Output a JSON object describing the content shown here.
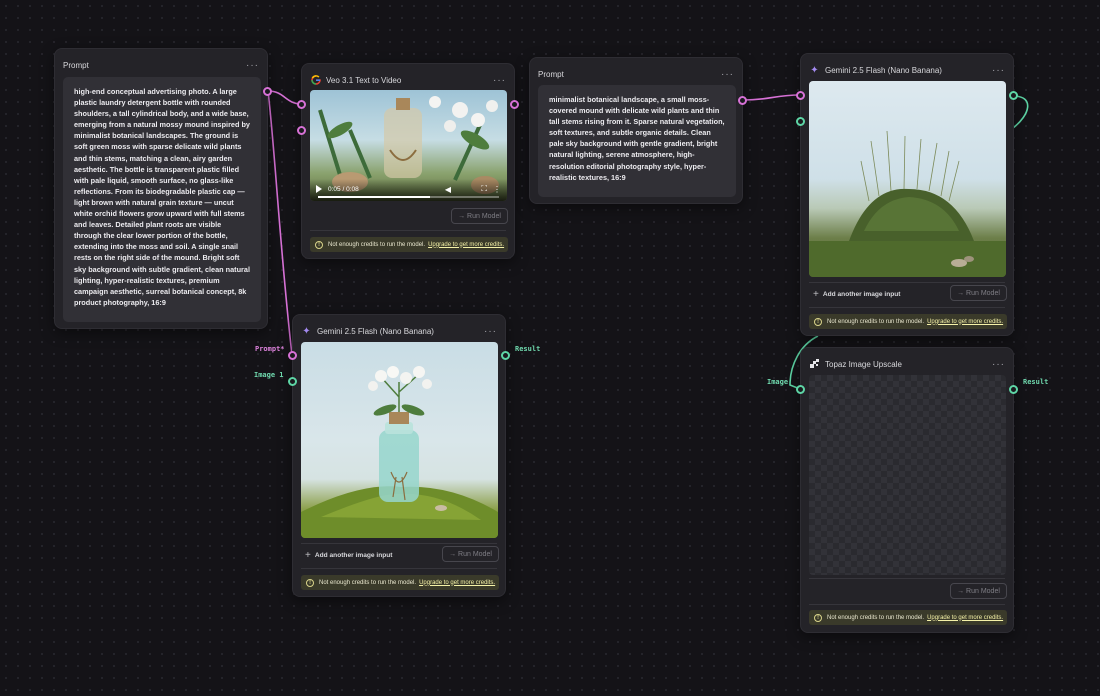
{
  "common": {
    "menu": "···",
    "run_model": "→ Run Model",
    "add_image_input": "Add another image input",
    "credits_text": "Not enough credits to run the model.",
    "credits_link": "Upgrade to get more credits."
  },
  "prompt1": {
    "title": "Prompt",
    "text": "high-end conceptual advertising photo. A large plastic laundry detergent bottle with rounded shoulders, a tall cylindrical body, and a wide base, emerging from a natural mossy mound inspired by minimalist botanical landscapes. The ground is soft green moss with sparse delicate wild plants and thin stems, matching a clean, airy garden aesthetic. The bottle is transparent plastic filled with pale liquid, smooth surface, no glass-like reflections. From its biodegradable plastic cap — light brown with natural grain texture — uncut white orchid flowers grow upward with full stems and leaves. Detailed plant roots are visible through the clear lower portion of the bottle, extending into the moss and soil. A single snail rests on the right side of the mound. Bright soft sky background with subtle gradient, clean natural lighting, hyper-realistic textures, premium campaign aesthetic, surreal botanical concept, 8k product photography, 16:9"
  },
  "veo": {
    "title": "Veo 3.1 Text to Video",
    "time": "0:05 / 0:08",
    "progress": 0.62
  },
  "prompt2": {
    "title": "Prompt",
    "text": "minimalist botanical landscape, a small moss-covered mound with delicate wild plants and thin tall stems rising from it. Sparse natural vegetation, soft textures, and subtle organic details. Clean pale sky background with gentle gradient, bright natural lighting, serene atmosphere, high-resolution editorial photography style, hyper-realistic textures, 16:9"
  },
  "gemini_top": {
    "title": "Gemini 2.5 Flash (Nano Banana)"
  },
  "gemini_mid": {
    "title": "Gemini 2.5 Flash (Nano Banana)",
    "port_prompt": "Prompt*",
    "port_image": "Image 1",
    "port_result": "Result"
  },
  "topaz": {
    "title": "Topaz Image Upscale",
    "port_image": "Image",
    "port_result": "Result"
  },
  "colors": {
    "pink_wire": "#d771d6",
    "green_wire": "#5ed6a6",
    "node_bg": "#242328",
    "canvas_bg": "#141317"
  }
}
